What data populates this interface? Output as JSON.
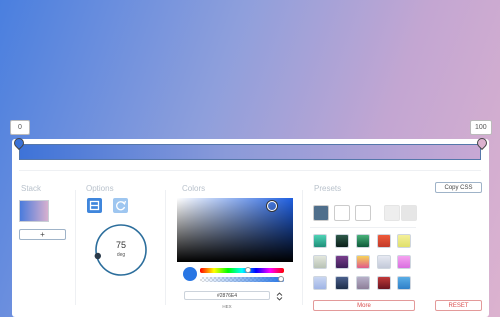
{
  "stops": {
    "left_label": "0",
    "right_label": "100",
    "left_color": "#3A71D7",
    "right_color": "#DCB2CF"
  },
  "stack": {
    "title": "Stack",
    "add_label": "+"
  },
  "options": {
    "title": "Options",
    "angle_value": "75",
    "angle_unit": "deg",
    "angle_degrees": 75
  },
  "colors": {
    "title": "Colors",
    "hex_value": "#2876E4",
    "hex_mode_label": "HEX",
    "current_color": "#2876E4"
  },
  "presets": {
    "title": "Presets",
    "copy_css_label": "Copy CSS",
    "more_label": "More",
    "reset_label": "RESET"
  }
}
